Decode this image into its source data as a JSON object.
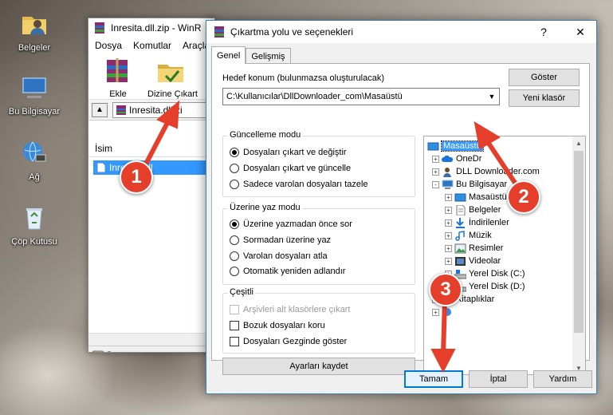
{
  "desktop": {
    "icons": [
      {
        "label": "Belgeler",
        "icon": "user-folder-icon"
      },
      {
        "label": "Bu Bilgisayar",
        "icon": "computer-icon"
      },
      {
        "label": "Ağ",
        "icon": "network-icon"
      },
      {
        "label": "Çöp Kutusu",
        "icon": "recycle-bin-icon"
      }
    ]
  },
  "winrar": {
    "title": "Inresita.dll.zip - WinR",
    "menu": [
      "Dosya",
      "Komutlar",
      "Araçla"
    ],
    "toolbar": {
      "add_label": "Ekle",
      "extract_label": "Dizine Çıkart"
    },
    "path": "Inresita.dll.zi",
    "column_name": "İsim",
    "file_name": "Inresita.dll"
  },
  "dialog": {
    "title": "Çıkartma yolu ve seçenekleri",
    "help_button": "?",
    "close_button": "✕",
    "tabs": [
      "Genel",
      "Gelişmiş"
    ],
    "dest_label": "Hedef konum (bulunmazsa oluşturulacak)",
    "dest_value": "C:\\Kullanıcılar\\DllDownloader_com\\Masaüstü",
    "show_button": "Göster",
    "new_folder_button": "Yeni klasör",
    "update_mode": {
      "title": "Güncelleme modu",
      "options": [
        "Dosyaları çıkart ve değiştir",
        "Dosyaları çıkart ve güncelle",
        "Sadece varolan dosyaları tazele"
      ],
      "selected": 0
    },
    "overwrite_mode": {
      "title": "Üzerine yaz modu",
      "options": [
        "Üzerine yazmadan önce sor",
        "Sormadan üzerine yaz",
        "Varolan dosyaları atla",
        "Otomatik yeniden adlandır"
      ],
      "selected": 0
    },
    "misc": {
      "title": "Çeşitli",
      "options": [
        "Arşivleri alt klasörlere çıkart",
        "Bozuk dosyaları koru",
        "Dosyaları Gezginde göster"
      ],
      "disabled": [
        true,
        false,
        false
      ]
    },
    "save_settings_button": "Ayarları kaydet",
    "tree": [
      {
        "label": "Masaüstü",
        "icon": "desktop-icon",
        "level": 0,
        "selected": true,
        "expander": ""
      },
      {
        "label": "OneDr",
        "icon": "cloud-icon",
        "level": 1,
        "expander": "+"
      },
      {
        "label": "DLL Downloader.com",
        "icon": "user-icon",
        "level": 1,
        "expander": "+"
      },
      {
        "label": "Bu Bilgisayar",
        "icon": "computer-icon",
        "level": 1,
        "expander": "-"
      },
      {
        "label": "Masaüstü",
        "icon": "desktop-icon",
        "level": 2,
        "expander": "+"
      },
      {
        "label": "Belgeler",
        "icon": "document-icon",
        "level": 2,
        "expander": "+"
      },
      {
        "label": "İndirilenler",
        "icon": "download-icon",
        "level": 2,
        "expander": "+"
      },
      {
        "label": "Müzik",
        "icon": "music-icon",
        "level": 2,
        "expander": "+"
      },
      {
        "label": "Resimler",
        "icon": "picture-icon",
        "level": 2,
        "expander": "+"
      },
      {
        "label": "Videolar",
        "icon": "video-icon",
        "level": 2,
        "expander": "+"
      },
      {
        "label": "Yerel Disk (C:)",
        "icon": "drive-icon",
        "level": 2,
        "expander": "+"
      },
      {
        "label": "Yerel Disk (D:)",
        "icon": "drive-icon",
        "level": 2,
        "expander": "+"
      },
      {
        "label": "Kitaplıklar",
        "icon": "library-icon",
        "level": 1,
        "expander": "+"
      },
      {
        "label": "",
        "icon": "network-icon",
        "level": 1,
        "expander": "+"
      }
    ],
    "ok_button": "Tamam",
    "cancel_button": "İptal",
    "help2_button": "Yardım"
  },
  "annotations": {
    "badges": [
      "1",
      "2",
      "3"
    ],
    "color": "#e53e2b"
  }
}
